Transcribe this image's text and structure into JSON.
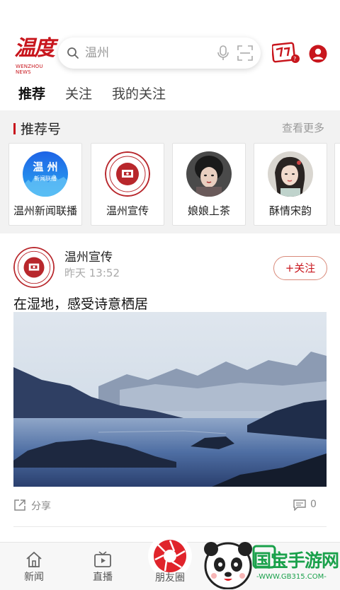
{
  "header": {
    "logo_main": "温度",
    "logo_sub": "WENZHOU NEWS",
    "search_placeholder": "温州"
  },
  "tabs": [
    {
      "label": "推荐"
    },
    {
      "label": "关注"
    },
    {
      "label": "我的关注"
    }
  ],
  "recommend": {
    "title": "推荐号",
    "more": "查看更多",
    "cards": [
      {
        "label": "温州新闻联播",
        "avatar_text": "温州新闻联播"
      },
      {
        "label": "温州宣传"
      },
      {
        "label": "娘娘上茶"
      },
      {
        "label": "酥情宋韵"
      }
    ]
  },
  "post": {
    "author": "温州宣传",
    "time": "昨天  13:52",
    "follow": "+关注",
    "title": "在湿地，感受诗意栖居",
    "share": "分享",
    "comments": "0"
  },
  "bottom_nav": {
    "items": [
      {
        "label": "新闻"
      },
      {
        "label": "直播"
      },
      {
        "label": "朋友圈"
      }
    ]
  },
  "watermark": {
    "text": "国宝手游网",
    "url": "-WWW.GB315.COM-"
  },
  "colors": {
    "brand_red": "#c8161d",
    "watermark_green": "#1aa14b"
  }
}
